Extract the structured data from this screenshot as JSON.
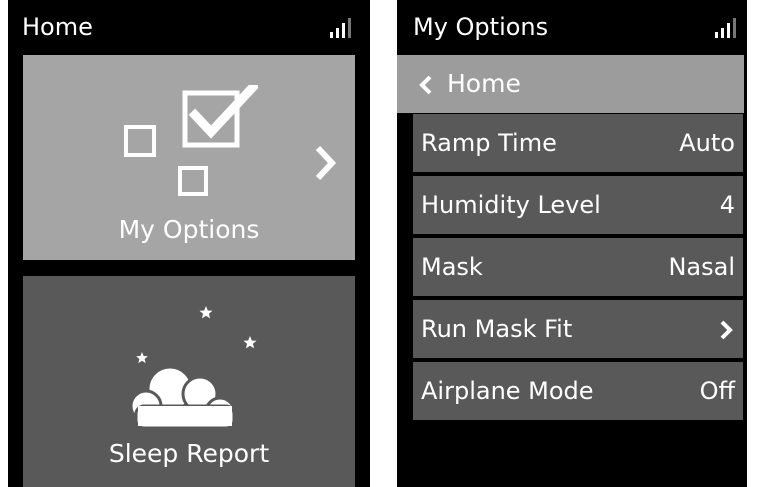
{
  "home_screen": {
    "title": "Home",
    "status": {
      "signal_icon": "signal-strength-icon"
    },
    "tiles": [
      {
        "label": "My Options",
        "icon": "options-checkbox-icon",
        "indicator": "chevron-right-icon"
      },
      {
        "label": "Sleep Report",
        "icon": "moon-cloud-icon"
      }
    ]
  },
  "options_screen": {
    "title": "My Options",
    "status": {
      "signal_icon": "signal-strength-icon"
    },
    "back": {
      "label": "Home",
      "icon": "chevron-left-icon"
    },
    "items": [
      {
        "label": "Ramp Time",
        "value": "Auto"
      },
      {
        "label": "Humidity Level",
        "value": "4"
      },
      {
        "label": "Mask",
        "value": "Nasal"
      },
      {
        "label": "Run Mask Fit",
        "value": "",
        "indicator": "chevron-right-icon"
      },
      {
        "label": "Airplane Mode",
        "value": "Off"
      }
    ]
  },
  "colors": {
    "screen_background": "#000000",
    "selected_tile": "#a5a5a5",
    "tile": "#595959",
    "back_row": "#9c9c9c",
    "text": "#ffffff"
  }
}
